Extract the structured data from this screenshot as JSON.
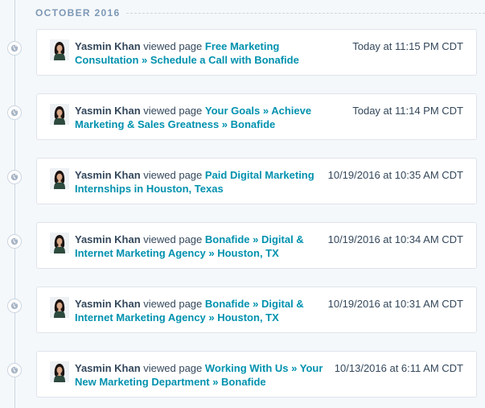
{
  "timeline": {
    "month_label": "OCTOBER 2016",
    "events": [
      {
        "user": "Yasmin Khan",
        "action": "viewed page",
        "page": "Free Marketing Consultation » Schedule a Call with Bonafide",
        "time": "Today at 11:15 PM CDT"
      },
      {
        "user": "Yasmin Khan",
        "action": "viewed page",
        "page": "Your Goals » Achieve Marketing & Sales Greatness » Bonafide",
        "time": "Today at 11:14 PM CDT"
      },
      {
        "user": "Yasmin Khan",
        "action": "viewed page",
        "page": "Paid Digital Marketing Internships in Houston, Texas",
        "time": "10/19/2016 at 10:35 AM CDT"
      },
      {
        "user": "Yasmin Khan",
        "action": "viewed page",
        "page": "Bonafide » Digital & Internet Marketing Agency » Houston, TX",
        "time": "10/19/2016 at 10:34 AM CDT"
      },
      {
        "user": "Yasmin Khan",
        "action": "viewed page",
        "page": "Bonafide » Digital & Internet Marketing Agency » Houston, TX",
        "time": "10/19/2016 at 10:31 AM CDT"
      },
      {
        "user": "Yasmin Khan",
        "action": "viewed page",
        "page": "Working With Us » Your New Marketing Department » Bonafide",
        "time": "10/13/2016 at 6:11 AM CDT"
      }
    ],
    "event_icon": "globe-icon",
    "colors": {
      "link": "#0091ae",
      "text": "#33475b",
      "muted": "#7c98b6",
      "background": "#f5f8fa"
    }
  }
}
